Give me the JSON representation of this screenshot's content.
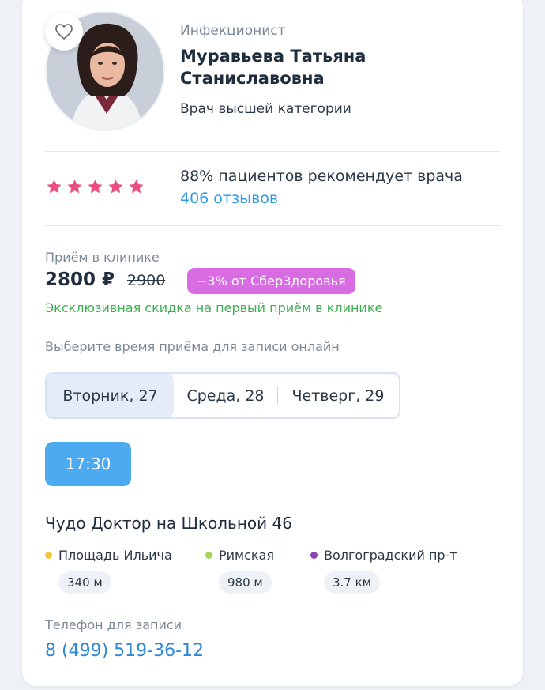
{
  "doctor": {
    "specialty": "Инфекционист",
    "name": "Муравьева Татьяна Станиславовна",
    "category": "Врач высшей категории"
  },
  "rating": {
    "stars": 5,
    "star_color": "#ec4f7f",
    "recommend_text": "88% пациентов рекомендует врача",
    "reviews_link": "406 отзывов"
  },
  "pricing": {
    "visit_label": "Приём в клинике",
    "price": "2800 ₽",
    "old_price": "2900",
    "discount_badge": "−3% от СберЗдоровья",
    "discount_color": "#d96be3",
    "exclusive_note": "Эксклюзивная скидка на первый приём в клинике"
  },
  "schedule": {
    "prompt": "Выберите время приёма для записи онлайн",
    "days": [
      {
        "label": "Вторник, 27",
        "selected": true
      },
      {
        "label": "Среда, 28",
        "selected": false
      },
      {
        "label": "Четверг, 29",
        "selected": false
      }
    ],
    "slots": [
      "17:30"
    ]
  },
  "clinic": {
    "name": "Чудо Доктор на Школьной 46",
    "metro": [
      {
        "station": "Площадь Ильича",
        "distance": "340 м",
        "color": "#f5c842"
      },
      {
        "station": "Римская",
        "distance": "980 м",
        "color": "#a8d65a"
      },
      {
        "station": "Волгоградский пр-т",
        "distance": "3.7 км",
        "color": "#8e44ad"
      }
    ]
  },
  "contact": {
    "phone_label": "Телефон для записи",
    "phone": "8 (499) 519-36-12"
  },
  "icons": {
    "favorite": "heart-outline-icon",
    "star": "star-icon"
  }
}
